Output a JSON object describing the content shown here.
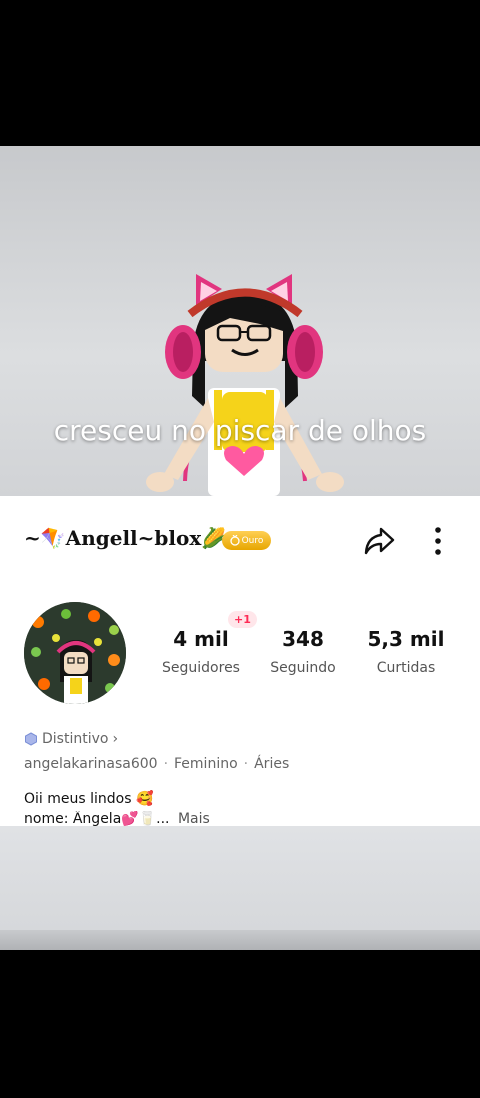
{
  "video": {
    "caption": "cresceu no piscar de olhos"
  },
  "profile": {
    "name_prefix": "~",
    "kite_emoji": "🪁",
    "name": "Angell~blox",
    "corn_emoji": "🌽",
    "badge_label": "Ouro"
  },
  "stats": {
    "followers_delta": "+1",
    "followers": {
      "value": "4 mil",
      "label": "Seguidores"
    },
    "following": {
      "value": "348",
      "label": "Seguindo"
    },
    "likes": {
      "value": "5,3 mil",
      "label": "Curtidas"
    }
  },
  "distintivo": {
    "label": "Distintivo",
    "chevron": "›"
  },
  "info": {
    "handle": "angelakarinasa600",
    "gender": "Feminino",
    "sign": "Áries",
    "separator": "·"
  },
  "bio": {
    "line1": "Oii meus lindos 🥰",
    "line2": "nome: Ângela💕🥛...",
    "more": "Mais"
  },
  "icons": [
    "share-icon",
    "more-vertical-icon",
    "hexagon-badge-icon",
    "gold-medal-icon"
  ],
  "colors": {
    "accent": "#fe2c55",
    "gold": "#f0b400",
    "badge_blue": "#7b8fd6"
  }
}
